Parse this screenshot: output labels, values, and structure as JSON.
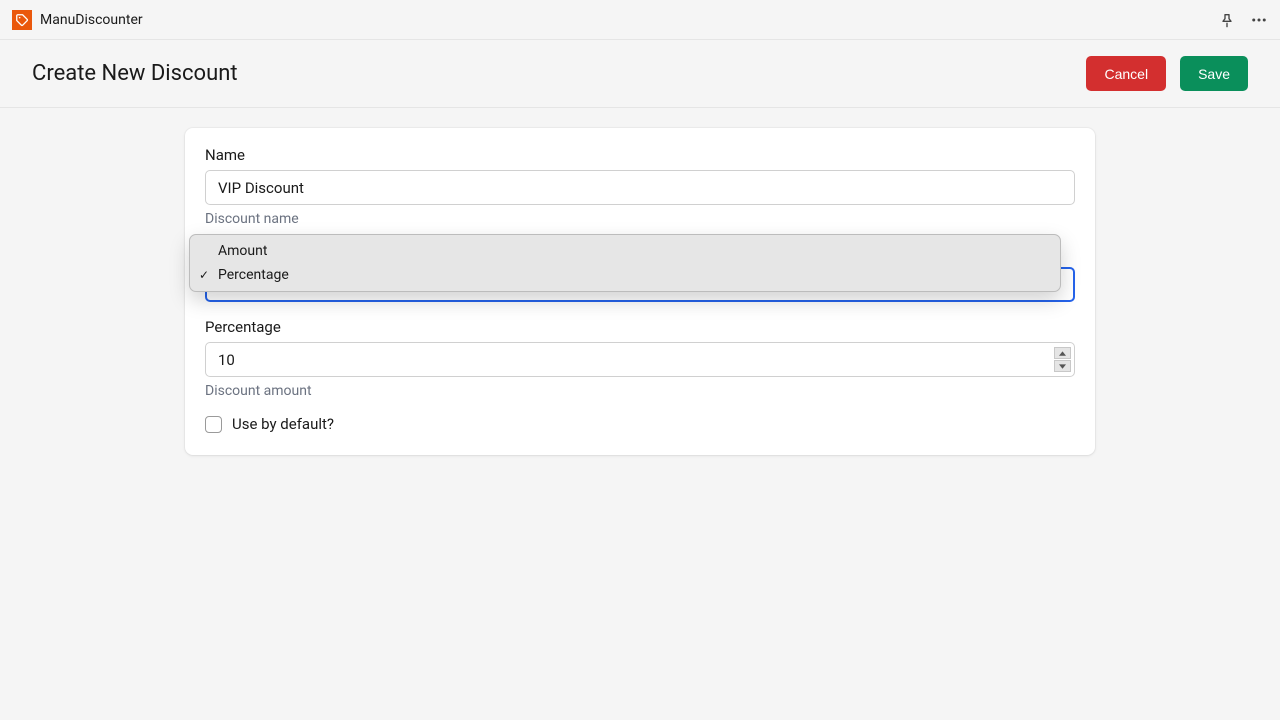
{
  "app": {
    "name": "ManuDiscounter"
  },
  "header": {
    "title": "Create New Discount",
    "cancel_label": "Cancel",
    "save_label": "Save"
  },
  "form": {
    "name": {
      "label": "Name",
      "value": "VIP Discount",
      "help": "Discount name"
    },
    "type": {
      "options": [
        "Amount",
        "Percentage"
      ],
      "selected": "Percentage"
    },
    "percentage": {
      "label": "Percentage",
      "value": "10",
      "help": "Discount amount"
    },
    "use_default": {
      "label": "Use by default?",
      "checked": false
    }
  },
  "icons": {
    "pin": "pin-icon",
    "more": "more-icon",
    "tag": "tag-icon"
  }
}
